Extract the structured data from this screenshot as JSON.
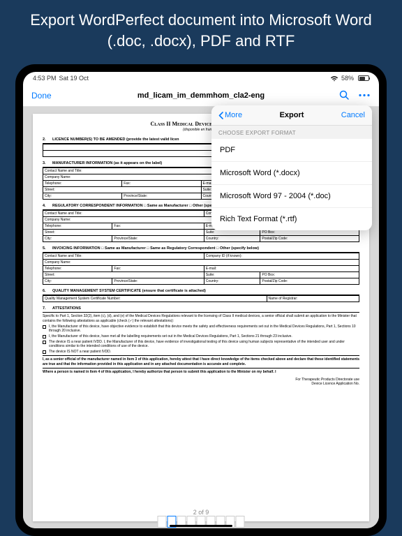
{
  "header": "Export WordPerfect document into Microsoft Word (.doc, .docx), PDF and RTF",
  "status": {
    "time": "4:53 PM",
    "date": "Sat 19 Oct",
    "battery": "58%"
  },
  "nav": {
    "done": "Done",
    "title": "md_licam_im_demmhom_cla2-eng"
  },
  "popover": {
    "back": "More",
    "title": "Export",
    "cancel": "Cancel",
    "section": "CHOOSE EXPORT FORMAT",
    "items": [
      "PDF",
      "Microsoft Word (*.docx)",
      "Microsoft Word 97 - 2004 (*.doc)",
      "Rich Text Format (*.rtf)"
    ]
  },
  "doc": {
    "title": "Class II Medical Device Licence Amend",
    "subtitle": "(disponible en français)",
    "s2": {
      "n": "2.",
      "t": "LICENCE NUMBER(S) TO BE AMENDED (provide the latest valid licen"
    },
    "s3": {
      "n": "3.",
      "t": "MANUFACTURER INFORMATION (as it appears on the label)"
    },
    "s4": {
      "n": "4.",
      "t": "REGULATORY CORRESPONDENT INFORMATION □ Same as Manufacturer    □ Other (specify below)"
    },
    "s5": {
      "n": "5.",
      "t": "INVOICING INFORMATION    □ Same as Manufacturer    □ Same as Regulatory Correspondent □ Other (specify below)"
    },
    "s6": {
      "n": "6.",
      "t": "QUALITY MANAGEMENT SYSTEM CERTIFICATE (ensure that certificate is attached)"
    },
    "s7": {
      "n": "7.",
      "t": "ATTESTATIONS"
    },
    "rows": {
      "contact": "Contact Name and Title:",
      "company": "Company Name:",
      "tel": "Telephone:",
      "fax": "Fax:",
      "email": "E-mail:",
      "street": "Street:",
      "suite": "Suite:",
      "po": "PO Box:",
      "city": "City:",
      "prov": "Province/State:",
      "country": "Country:",
      "zip": "Postal/Zip Code:",
      "compid": "Company ID (if known):",
      "cert": "Quality Management System Certificate Number:",
      "reg": "Name of Registrar:"
    },
    "att": {
      "intro": "Specific to Part 1, Section 32(2), item (c), (d), and (e) of the Medical Devices Regulations relevant to the licensing of Class II medical devices, a senior official shall submit an application to the Minister that contains the following attestations as applicable (check (✓) the relevant attestations):",
      "i1": "I, the Manufacturer of this device, have objective evidence to establish that this device meets the safety and effectiveness requirements set out in the Medical Devices Regulations, Part 1, Sections 10 through 20 inclusive.",
      "i2": "I, the Manufacturer of this device, have met all the labelling requirements set out in the Medical Devices Regulations, Part 1, Sections 21 through 23 inclusive.",
      "i3": "The device IS a near patient IVDD. I, the Manufacturer of this device, have evidence of investigational testing of this device using human subjects representative of the intended user and under conditions similar to the intended conditions of use of the device.",
      "i4": "The device IS NOT a near patient IVDD.",
      "cert": "I, as a senior official of the manufacturer named in Item 3 of this application, hereby attest that I have direct knowledge of the items checked above and declare that these identified statements are true and that the information provided in this application and in any attached documentation is accurate and complete.",
      "auth": "Where a person is named in Item 4 of this application, I hereby authorize that person to submit this application to the Minister on my behalf. I"
    },
    "footer1": "For Therapeutic Products Directorate use",
    "footer2": "Device Licence Application No.",
    "page": "2 of 9"
  }
}
